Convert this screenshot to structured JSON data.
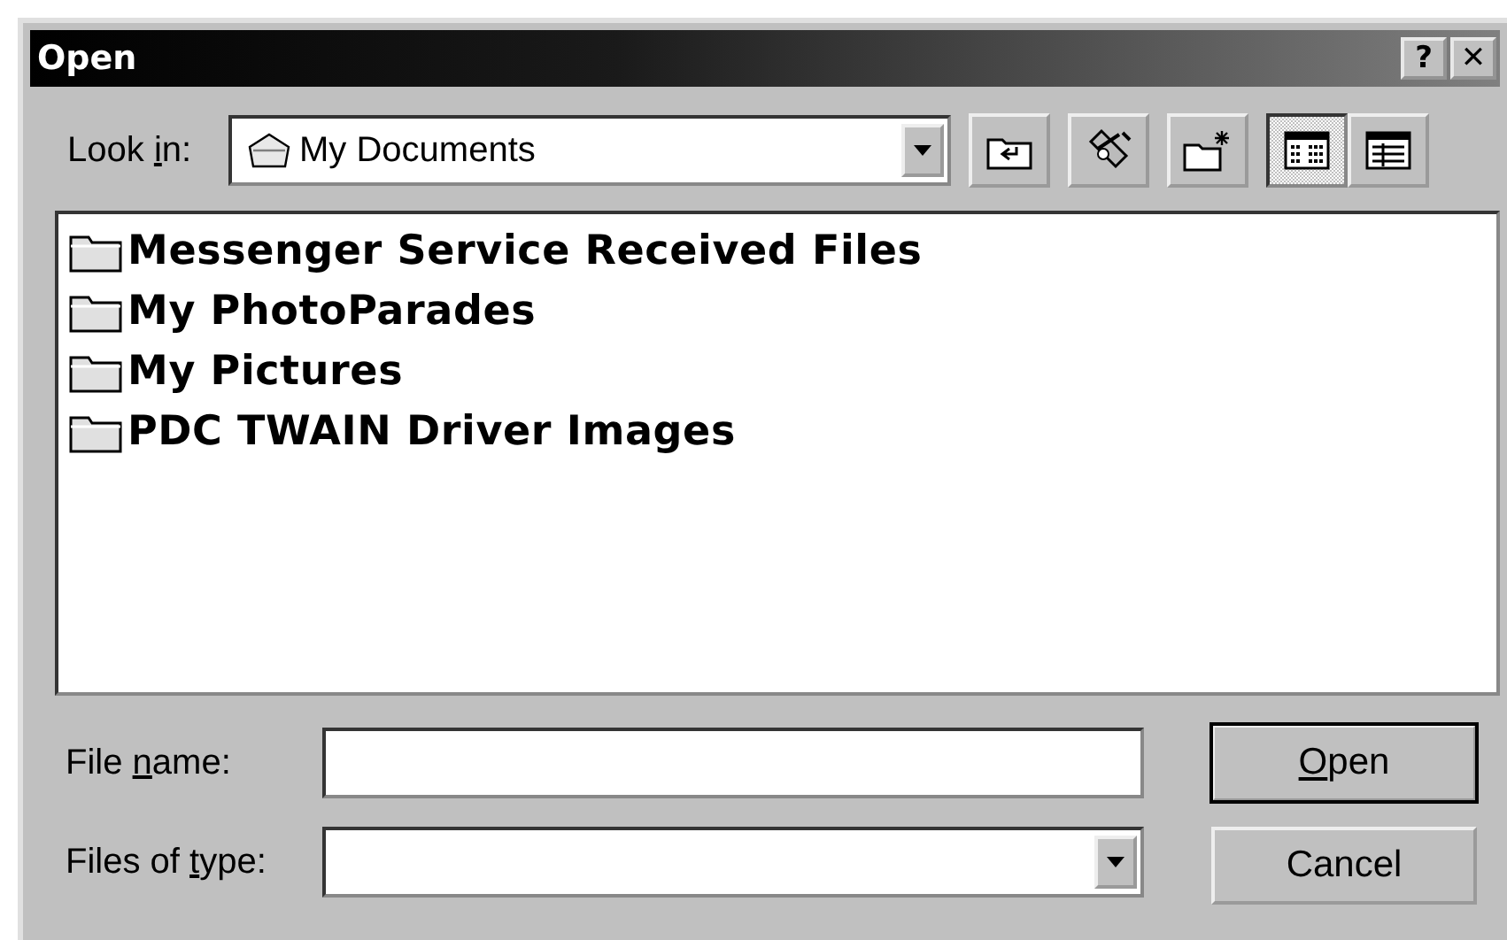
{
  "window": {
    "title": "Open",
    "buttons": [
      "?",
      "✕"
    ]
  },
  "look_in": {
    "label": {
      "pre": "Look ",
      "key": "i",
      "post": "n:"
    },
    "value": "My Documents"
  },
  "toolbar": [
    {
      "kind": "up",
      "selected": false
    },
    {
      "kind": "desktop",
      "selected": false
    },
    {
      "kind": "newfolder",
      "selected": false
    },
    {
      "kind": "list",
      "selected": true
    },
    {
      "kind": "details",
      "selected": false
    }
  ],
  "files": [
    {
      "name": "Messenger Service Received Files"
    },
    {
      "name": "My PhotoParades"
    },
    {
      "name": "My Pictures"
    },
    {
      "name": "PDC TWAIN Driver Images"
    }
  ],
  "file_name": {
    "label": {
      "pre": "File ",
      "key": "n",
      "post": "ame:"
    }
  },
  "files_of_type": {
    "label": {
      "pre": "Files of ",
      "key": "t",
      "post": "ype:"
    }
  },
  "buttons": [
    {
      "label": {
        "key": "O",
        "post": "pen"
      },
      "default": true
    },
    {
      "label": {
        "post": "Cancel"
      },
      "default": false
    }
  ]
}
